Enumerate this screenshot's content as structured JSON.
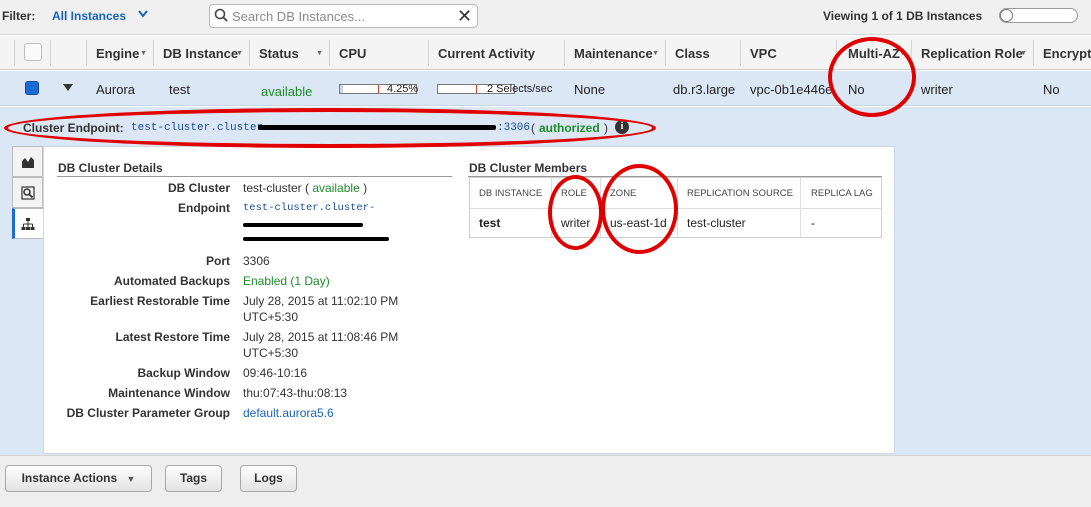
{
  "filter": {
    "label": "Filter:",
    "selected": "All Instances"
  },
  "search": {
    "placeholder": "Search DB Instances..."
  },
  "viewing": "Viewing 1 of 1 DB Instances",
  "columns": [
    "Engine",
    "DB Instance",
    "Status",
    "CPU",
    "Current Activity",
    "Maintenance",
    "Class",
    "VPC",
    "Multi-AZ",
    "Replication Role",
    "Encrypt"
  ],
  "row": {
    "engine": "Aurora",
    "instance": "test",
    "status": "available",
    "cpu": "4.25%",
    "cpu_fraction": 0.0425,
    "activity": "2 Selects/sec",
    "maintenance": "None",
    "class": "db.r3.large",
    "vpc": "vpc-0b1e446e",
    "multi_az": "No",
    "replication_role": "writer",
    "encrypted": "No"
  },
  "endpoint": {
    "label": "Cluster Endpoint:",
    "value_prefix": "test-cluster.cluster-",
    "port_suffix": ":3306",
    "open_paren": "(",
    "auth": "authorized",
    "close_paren": ")"
  },
  "details": {
    "title": "DB Cluster Details",
    "cluster_label": "DB Cluster",
    "cluster_name": "test-cluster",
    "cluster_status": "available",
    "open_paren": "(",
    "close_paren": ")",
    "endpoint_label": "Endpoint",
    "endpoint_line1": "test-cluster.cluster-",
    "port_label": "Port",
    "port": "3306",
    "backups_label": "Automated Backups",
    "backups": "Enabled (1 Day)",
    "earliest_label": "Earliest Restorable Time",
    "earliest_1": "July 28, 2015 at 11:02:10 PM",
    "earliest_2": "UTC+5:30",
    "latest_label": "Latest Restore Time",
    "latest_1": "July 28, 2015 at 11:08:46 PM",
    "latest_2": "UTC+5:30",
    "backup_window_label": "Backup Window",
    "backup_window": "09:46-10:16",
    "maint_window_label": "Maintenance Window",
    "maint_window": "thu:07:43-thu:08:13",
    "param_group_label": "DB Cluster Parameter Group",
    "param_group": "default.aurora5.6"
  },
  "members": {
    "title": "DB Cluster Members",
    "headers": [
      "DB INSTANCE",
      "ROLE",
      "ZONE",
      "REPLICATION SOURCE",
      "REPLICA LAG"
    ],
    "row": [
      "test",
      "writer",
      "us-east-1d",
      "test-cluster",
      "-"
    ]
  },
  "actions": {
    "instance_actions": "Instance Actions",
    "tags": "Tags",
    "logs": "Logs"
  },
  "colors": {
    "accent": "#1a64b8",
    "available": "#1e8c2a",
    "annotation": "#e00000",
    "selected_row": "#dbe7f4"
  }
}
